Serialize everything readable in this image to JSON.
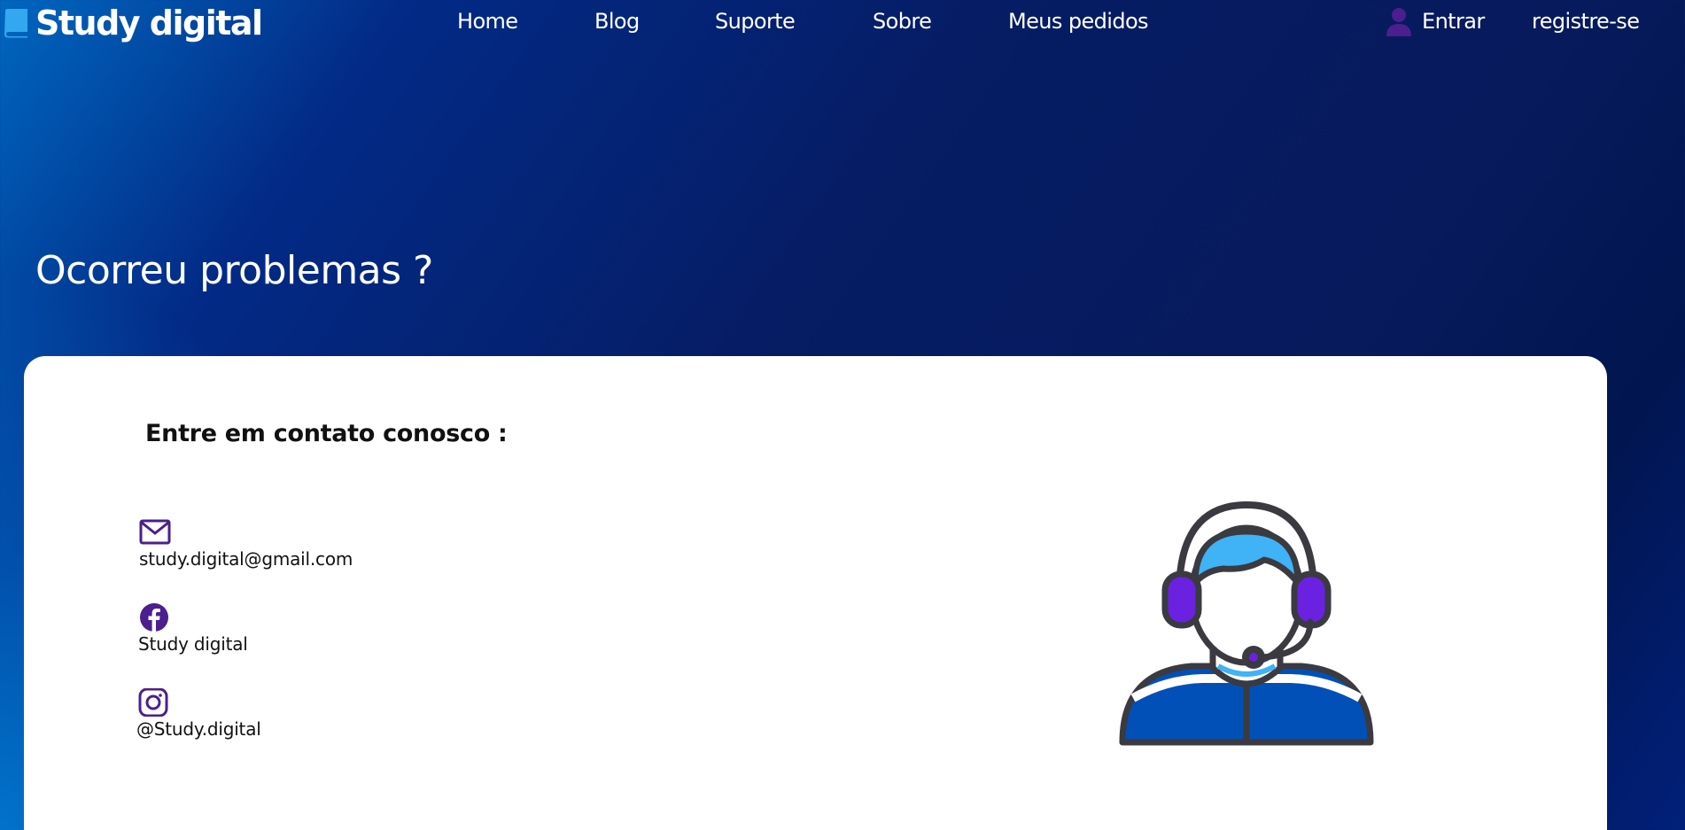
{
  "header": {
    "logo_text": "Study digital",
    "nav": [
      {
        "label": "Home"
      },
      {
        "label": "Blog"
      },
      {
        "label": "Suporte"
      },
      {
        "label": "Sobre"
      },
      {
        "label": "Meus pedidos"
      }
    ],
    "login_label": "Entrar",
    "register_label": "registre-se"
  },
  "main": {
    "title": "Ocorreu problemas ?",
    "card": {
      "heading": "Entre em contato conosco :",
      "contacts": [
        {
          "icon": "mail-icon",
          "value": "study.digital@gmail.com"
        },
        {
          "icon": "facebook-icon",
          "value": "Study digital"
        },
        {
          "icon": "instagram-icon",
          "value": "@Study.digital"
        }
      ]
    }
  },
  "colors": {
    "accent_purple": "#4b1f8e",
    "headset_purple": "#6a22e0",
    "illustration_blue": "#0050b8",
    "illustration_light_blue": "#3fb3f5",
    "outline": "#3a3a40"
  }
}
